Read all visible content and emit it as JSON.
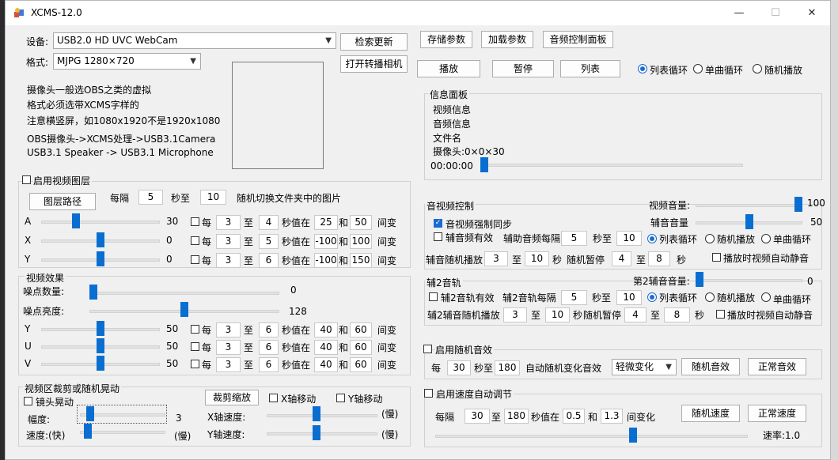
{
  "window": {
    "title": "XCMS-12.0",
    "minimize": "—",
    "maximize": "☐",
    "close": "✕"
  },
  "device": {
    "device_label": "设备:",
    "device_value": "USB2.0 HD UVC WebCam",
    "search_btn": "检索更新",
    "format_label": "格式:",
    "format_value": "MJPG 1280×720",
    "open_camera_btn": "打开转播相机",
    "tip1": "摄像头一般选OBS之类的虚拟",
    "tip2": "格式必须选带XCMS字样的",
    "tip3": "注意横竖屏，如1080x1920不是1920x1080",
    "tip4": "OBS摄像头->XCMS处理->USB3.1Camera",
    "tip5": "USB3.1 Speaker -> USB3.1 Microphone"
  },
  "toolbar": {
    "save": "存储参数",
    "load": "加载参数",
    "audio_panel": "音频控制面板",
    "play": "播放",
    "pause": "暂停",
    "list": "列表",
    "mode_list": "列表循环",
    "mode_single": "单曲循环",
    "mode_random": "随机播放"
  },
  "info": {
    "title": "信息面板",
    "video": "视频信息",
    "audio": "音频信息",
    "file": "文件名",
    "camera": "摄像头:0×0×30",
    "time": "00:00:00",
    "progress": 0.0
  },
  "layer": {
    "enable": "启用视频图层",
    "path_btn": "图层路径",
    "every": "每隔",
    "every_val": "5",
    "sec_to": "秒至",
    "to_val": "10",
    "random_text": "随机切换文件夹中的图片",
    "rows": [
      {
        "label": "A",
        "value": "30",
        "pos": 0.28,
        "every": "每",
        "v1": "3",
        "to": "至",
        "v2": "4",
        "between": "秒值在",
        "v3": "25",
        "and": "和",
        "v4": "50",
        "change": "间变"
      },
      {
        "label": "X",
        "value": "0",
        "pos": 0.5,
        "every": "每",
        "v1": "3",
        "to": "至",
        "v2": "5",
        "between": "秒值在",
        "v3": "-100",
        "and": "和",
        "v4": "100",
        "change": "间变"
      },
      {
        "label": "Y",
        "value": "0",
        "pos": 0.5,
        "every": "每",
        "v1": "3",
        "to": "至",
        "v2": "6",
        "between": "秒值在",
        "v3": "-100",
        "and": "和",
        "v4": "150",
        "change": "间变"
      }
    ]
  },
  "effects": {
    "title": "视频效果",
    "noise_count": "噪点数量:",
    "noise_count_val": "0",
    "noise_count_pos": 0.0,
    "noise_bright": "噪点亮度:",
    "noise_bright_val": "128",
    "noise_bright_pos": 0.5,
    "rows": [
      {
        "label": "Y",
        "value": "50",
        "pos": 0.5,
        "every": "每",
        "v1": "3",
        "to": "至",
        "v2": "6",
        "between": "秒值在",
        "v3": "40",
        "and": "和",
        "v4": "60",
        "change": "间变"
      },
      {
        "label": "U",
        "value": "50",
        "pos": 0.5,
        "every": "每",
        "v1": "3",
        "to": "至",
        "v2": "6",
        "between": "秒值在",
        "v3": "40",
        "and": "和",
        "v4": "60",
        "change": "间变"
      },
      {
        "label": "V",
        "value": "50",
        "pos": 0.5,
        "every": "每",
        "v1": "3",
        "to": "至",
        "v2": "6",
        "between": "秒值在",
        "v3": "40",
        "and": "和",
        "v4": "60",
        "change": "间变"
      }
    ]
  },
  "crop": {
    "title": "视频区裁剪或随机晃动",
    "shake": "镜头晃动",
    "amp": "幅度:",
    "amp_val": "3",
    "speed": "速度:(快)",
    "slow": "(慢)",
    "crop_btn": "裁剪缩放",
    "x_move": "X轴移动",
    "y_move": "Y轴移动",
    "x_speed": "X轴速度:",
    "y_speed": "Y轴速度:",
    "x_slow": "(慢)",
    "y_slow": "(慢)"
  },
  "audio": {
    "title": "音视频控制",
    "video_vol": "视频音量:",
    "video_vol_val": "100",
    "video_vol_pos": 1.0,
    "sync": "音视频强制同步",
    "aux_vol": "辅音音量",
    "aux_vol_val": "50",
    "aux_vol_pos": 0.5,
    "aux_valid": "辅音频有效",
    "aux_every": "辅助音频每隔",
    "aux_v1": "5",
    "sec_to": "秒至",
    "aux_v2": "10",
    "mode_list": "列表循环",
    "mode_random": "随机播放",
    "mode_single": "单曲循环",
    "aux_random": "辅音随机播放",
    "r1": "3",
    "to": "至",
    "r2": "10",
    "sec": "秒",
    "pause": "随机暂停",
    "p1": "4",
    "p2": "8",
    "sec2": "秒",
    "auto_mute": "播放时视频自动静音"
  },
  "track2": {
    "title": "辅2音轨",
    "vol": "第2辅音音量:",
    "vol_val": "0",
    "vol_pos": 0.0,
    "valid": "辅2音轨有效",
    "every": "辅2音轨每隔",
    "v1": "5",
    "sec_to": "秒至",
    "v2": "10",
    "mode_list": "列表循环",
    "mode_random": "随机播放",
    "mode_single": "单曲循环",
    "random": "辅2辅音随机播放",
    "r1": "3",
    "to": "至",
    "r2": "10",
    "sec": "秒",
    "pause": "随机暂停",
    "p1": "4",
    "p2": "8",
    "sec2": "秒",
    "auto_mute": "播放时视频自动静音"
  },
  "rand_fx": {
    "enable": "启用随机音效",
    "every": "每",
    "v1": "30",
    "sec_to": "秒至",
    "v2": "180",
    "auto": "自动随机变化音效",
    "level": "轻微变化",
    "random_btn": "随机音效",
    "normal_btn": "正常音效"
  },
  "speed": {
    "enable": "启用速度自动调节",
    "every": "每隔",
    "v1": "30",
    "to": "至",
    "v2": "180",
    "between": "秒值在",
    "v3": "0.5",
    "and": "和",
    "v4": "1.3",
    "change": "间变化",
    "random_btn": "随机速度",
    "normal_btn": "正常速度",
    "rate": "速率:1.0",
    "rate_pos": 0.5
  }
}
